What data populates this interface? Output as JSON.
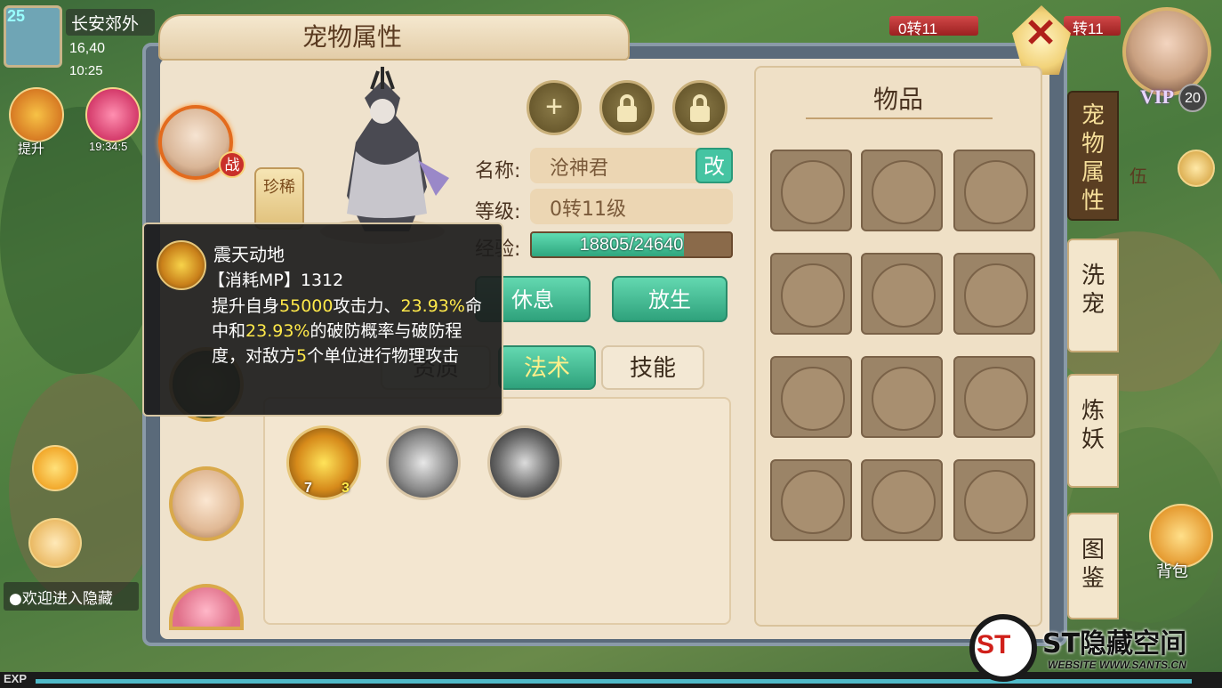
{
  "hud": {
    "level": "25",
    "location": "长安郊外",
    "coords": "16,40",
    "time": "10:25",
    "upgrade_label": "提升",
    "gift_timer": "19:34:5",
    "chat_text": "●欢迎进入隐藏",
    "exp_label": "EXP",
    "hp_left": "0转11",
    "hp_right": "转11",
    "vip_label": "VIP",
    "vip_level": "20",
    "team_label": "伍",
    "bag_label": "背包"
  },
  "window": {
    "title": "宠物属性",
    "close_icon": "close-x-icon"
  },
  "pet": {
    "battle_tag": "战",
    "rare_tag": "珍稀",
    "name_label": "名称:",
    "name_value": "沧神君",
    "rename_label": "改",
    "level_label": "等级:",
    "level_value": "0转11级",
    "exp_label": "经验:",
    "exp_value": "18805/24640",
    "exp_fraction": 0.763
  },
  "actions": {
    "rest_label": "休息",
    "release_label": "放生"
  },
  "tabs": [
    {
      "label": "资质",
      "active": false
    },
    {
      "label": "法术",
      "active": true
    },
    {
      "label": "技能",
      "active": false
    }
  ],
  "skill_badges": {
    "first_level_a": "7",
    "first_level_b": "3"
  },
  "items": {
    "title": "物品"
  },
  "side_tabs": [
    {
      "label": "宠物属性",
      "active": true
    },
    {
      "label": "洗宠",
      "active": false
    },
    {
      "label": "炼妖",
      "active": false
    },
    {
      "label": "图鉴",
      "active": false
    }
  ],
  "tooltip": {
    "title": "震天动地",
    "mp_line": "【消耗MP】1312",
    "desc_1": "提升自身",
    "desc_hl_1": "55000",
    "desc_2": "攻击力、",
    "desc_hl_2": "23.93%",
    "desc_3": "命中和",
    "desc_hl_3": "23.93%",
    "desc_4": "的破防概率与破防程度，对敌方",
    "desc_hl_4": "5",
    "desc_5": "个单位进行物理攻击"
  },
  "watermark": {
    "logo": "ST",
    "title": "ST隐藏空间",
    "sub": "WEBSITE WWW.SANTS.CN"
  }
}
